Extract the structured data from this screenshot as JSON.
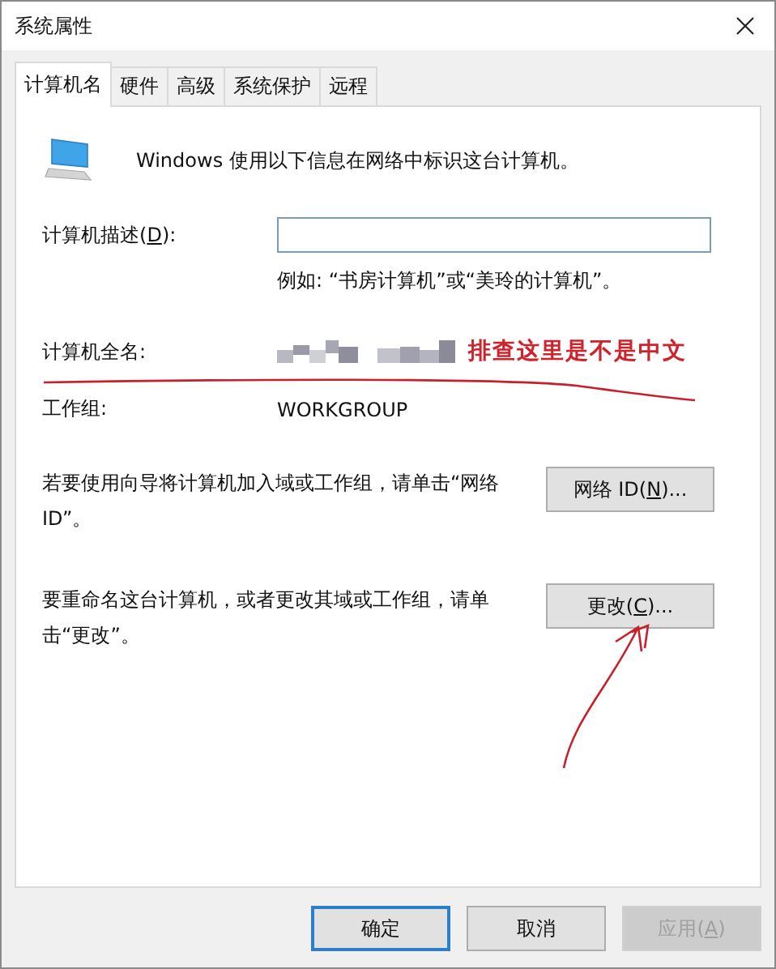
{
  "window": {
    "title": "系统属性"
  },
  "tabs": [
    {
      "label": "计算机名",
      "selected": true
    },
    {
      "label": "硬件",
      "selected": false
    },
    {
      "label": "高级",
      "selected": false
    },
    {
      "label": "系统保护",
      "selected": false
    },
    {
      "label": "远程",
      "selected": false
    }
  ],
  "intro": "Windows 使用以下信息在网络中标识这台计算机。",
  "description": {
    "label": {
      "before": "计算机描述(",
      "key": "D",
      "after": "):"
    },
    "hint": "例如: “书房计算机”或“美玲的计算机”。"
  },
  "full_name": {
    "label": "计算机全名:",
    "annotation": "排查这里是不是中文"
  },
  "workgroup": {
    "label": "工作组:",
    "value": "WORKGROUP"
  },
  "network_id": {
    "text": "若要使用向导将计算机加入域或工作组，请单击“网络 ID”。",
    "button": {
      "before": "网络 ID(",
      "key": "N",
      "after": ")..."
    }
  },
  "rename": {
    "text": "要重命名这台计算机，或者更改其域或工作组，请单击“更改”。",
    "button": {
      "before": "更改(",
      "key": "C",
      "after": ")..."
    }
  },
  "buttons": [
    {
      "before": "确定",
      "default": true,
      "disabled": false
    },
    {
      "before": "取消",
      "default": false,
      "disabled": false
    },
    {
      "before": "应用(",
      "key": "A",
      "after": ")",
      "default": false,
      "disabled": true
    }
  ]
}
